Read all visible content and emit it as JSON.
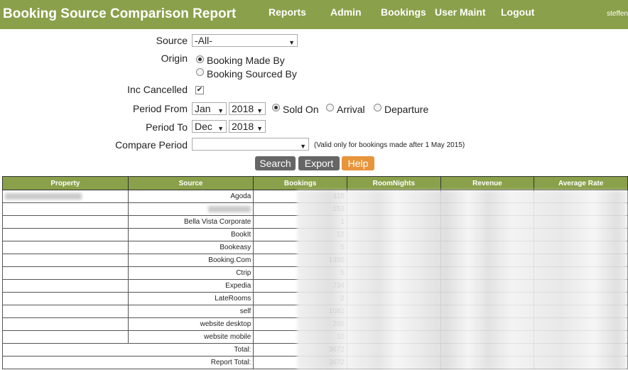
{
  "header": {
    "title": "Booking Source Comparison Report",
    "nav": [
      "Reports",
      "Admin",
      "Bookings",
      "User Maint",
      "Logout"
    ],
    "user": "steffen"
  },
  "form": {
    "source_label": "Source",
    "source_value": "-All-",
    "origin_label": "Origin",
    "origin_options": [
      "Booking Made By",
      "Booking Sourced By"
    ],
    "inc_cancelled_label": "Inc Cancelled",
    "period_from_label": "Period From",
    "period_from_month": "Jan",
    "period_from_year": "2018",
    "date_type_options": [
      "Sold On",
      "Arrival",
      "Departure"
    ],
    "period_to_label": "Period To",
    "period_to_month": "Dec",
    "period_to_year": "2018",
    "compare_label": "Compare Period",
    "compare_value": "",
    "compare_note": "(Valid only for bookings made after 1 May 2015)"
  },
  "buttons": {
    "search": "Search",
    "export": "Export",
    "help": "Help"
  },
  "colors": {
    "accent": "#8aa04a",
    "button": "#666666",
    "help": "#e8943a"
  },
  "table": {
    "columns": [
      "Property",
      "Source",
      "Bookings",
      "RoomNights",
      "Revenue",
      "Average Rate"
    ],
    "rows": [
      {
        "source": "Agoda",
        "bookings": "118"
      },
      {
        "source": "",
        "bookings": "153"
      },
      {
        "source": "Bella Vista Corporate",
        "bookings": "1"
      },
      {
        "source": "BookIt",
        "bookings": "12"
      },
      {
        "source": "Bookeasy",
        "bookings": "5"
      },
      {
        "source": "Booking.Com",
        "bookings": "1350"
      },
      {
        "source": "Ctrip",
        "bookings": "5"
      },
      {
        "source": "Expedia",
        "bookings": "734"
      },
      {
        "source": "LateRooms",
        "bookings": "2"
      },
      {
        "source": "self",
        "bookings": "1082"
      },
      {
        "source": "website desktop",
        "bookings": "200"
      },
      {
        "source": "website mobile",
        "bookings": "10"
      }
    ],
    "total_label": "Total:",
    "total_bookings": "3672",
    "report_total_label": "Report Total:",
    "report_total_bookings": "3672"
  }
}
